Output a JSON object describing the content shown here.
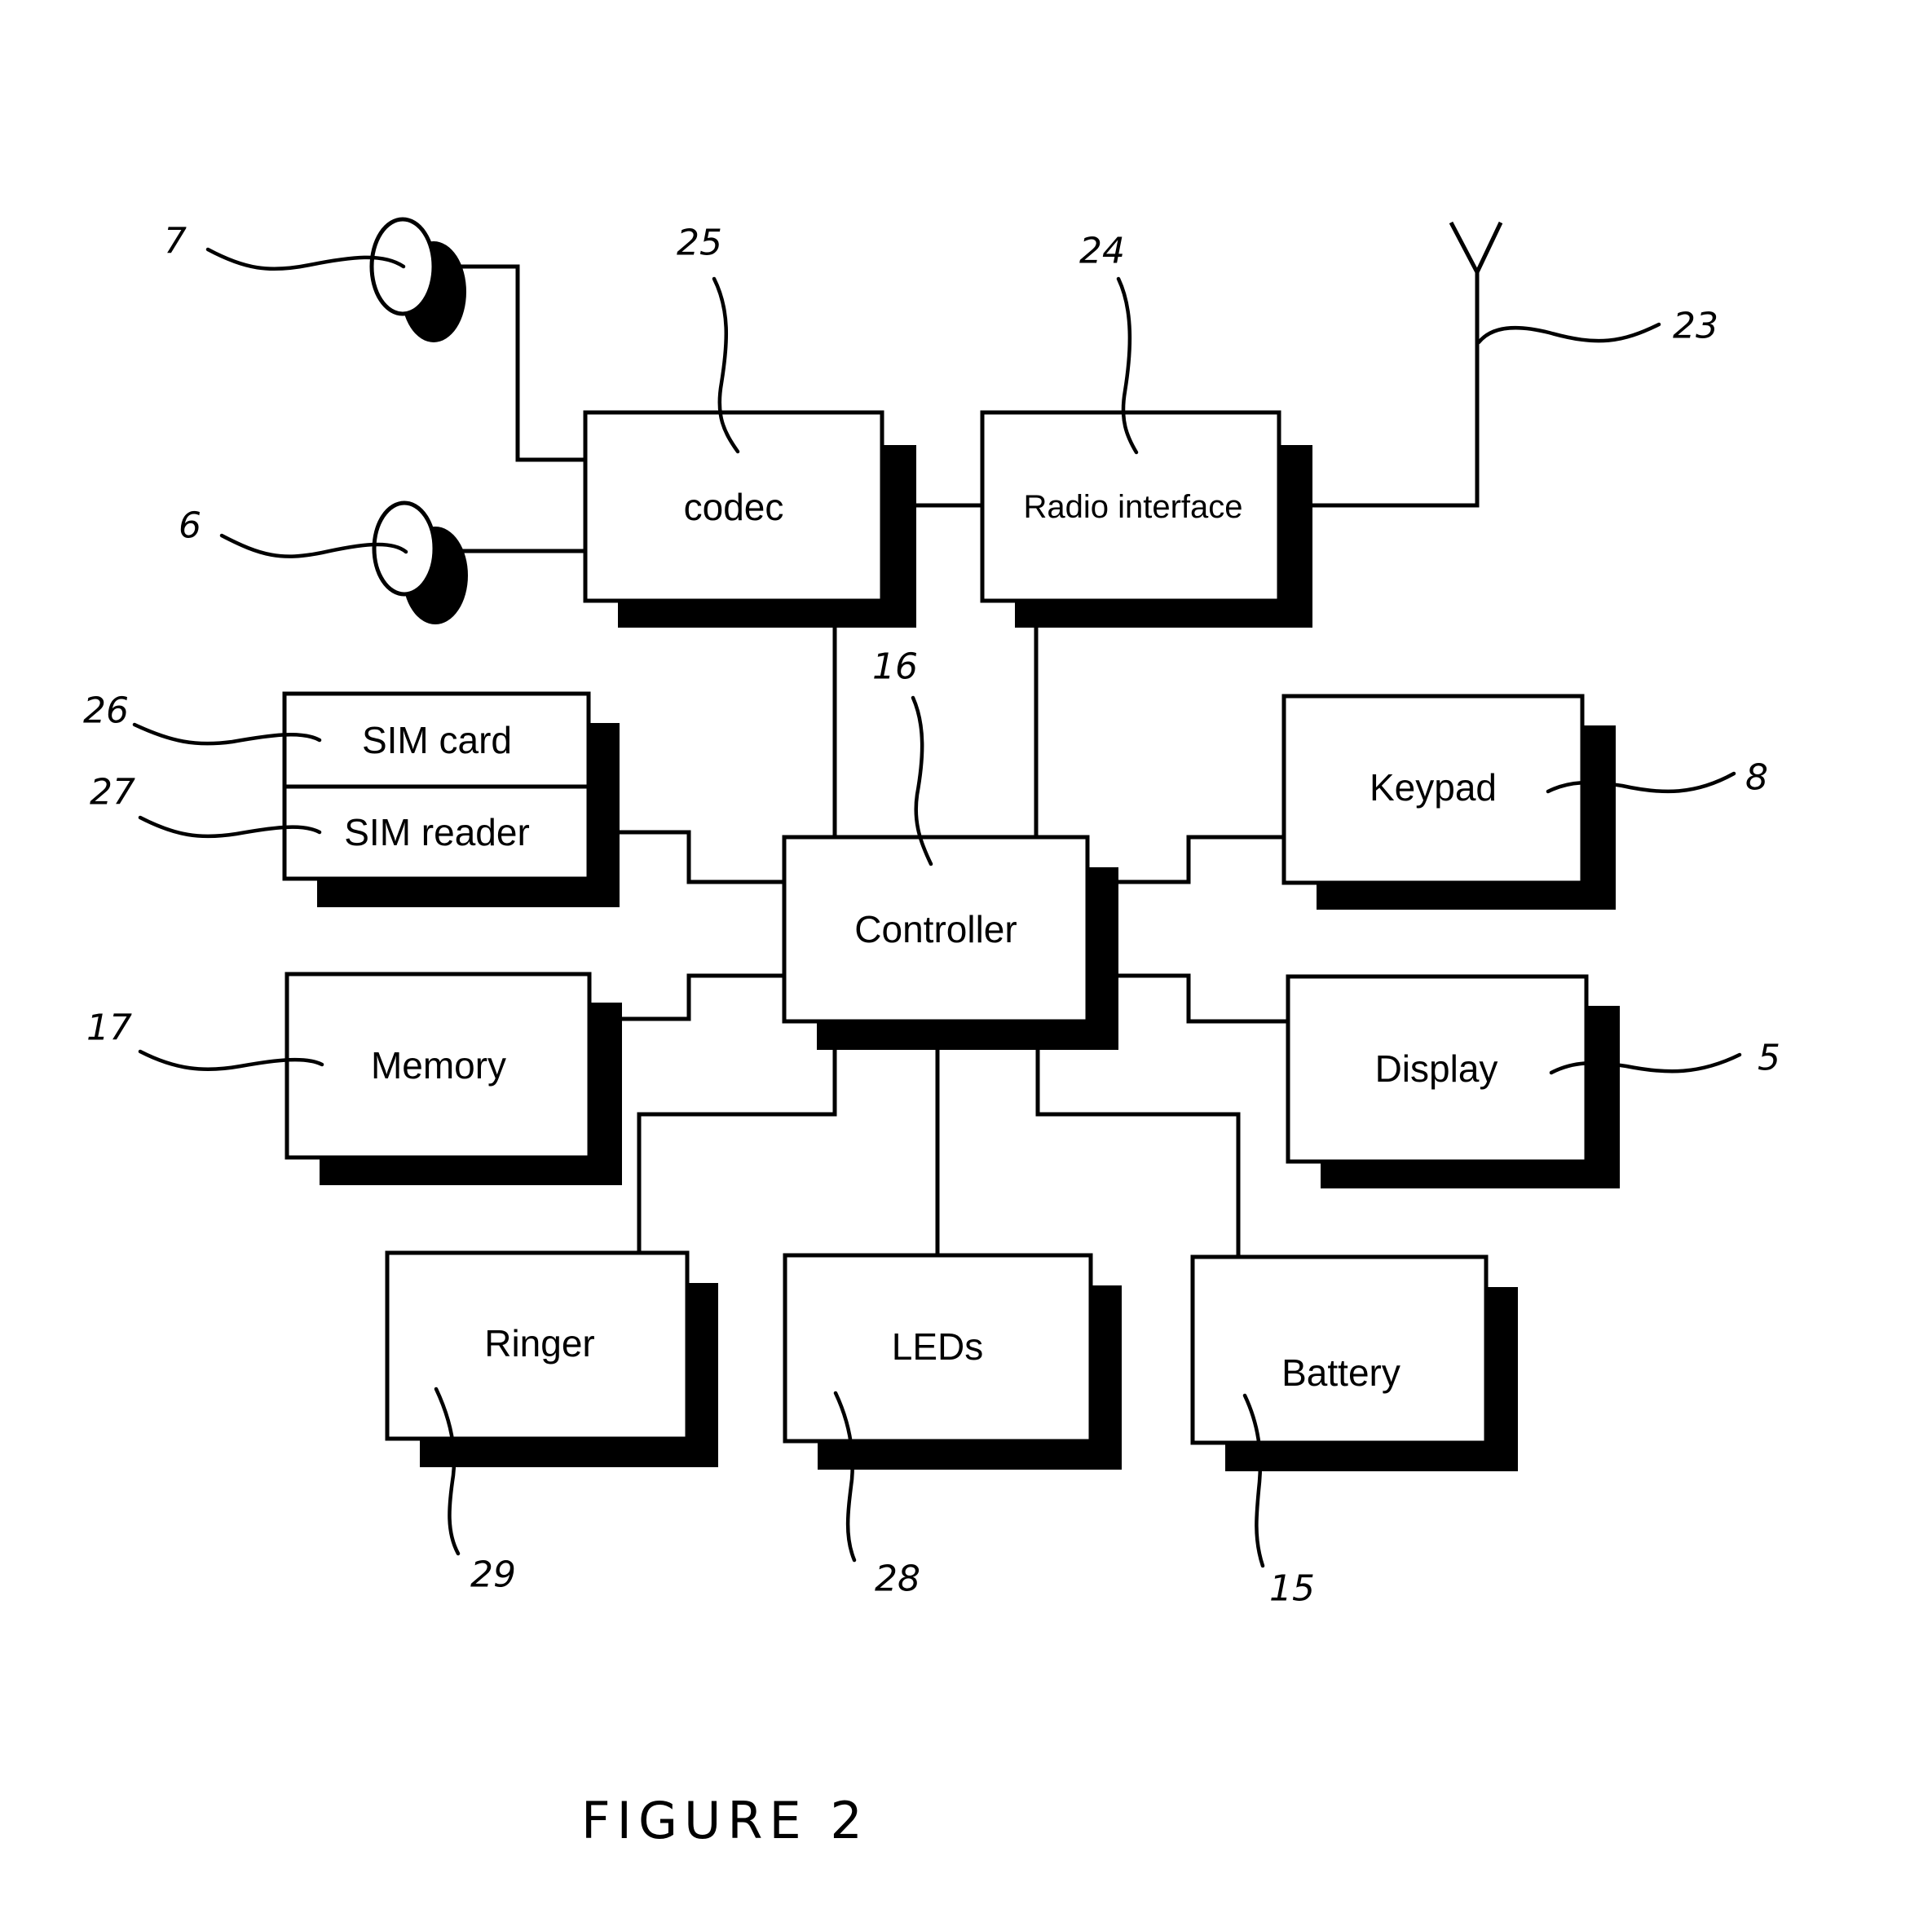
{
  "figure": {
    "caption": "Figure 2",
    "caption_display": "FIGURE 2",
    "type": "block diagram"
  },
  "blocks": {
    "codec": {
      "label": "codec",
      "ref": "25"
    },
    "radio": {
      "label": "Radio interface",
      "ref": "24"
    },
    "sim_card": {
      "label": "SIM card",
      "ref": "26"
    },
    "sim_reader": {
      "label": "SIM reader",
      "ref": "27"
    },
    "memory": {
      "label": "Memory",
      "ref": "17"
    },
    "controller": {
      "label": "Controller",
      "ref": "16"
    },
    "keypad": {
      "label": "Keypad",
      "ref": "8"
    },
    "display": {
      "label": "Display",
      "ref": "5"
    },
    "ringer": {
      "label": "Ringer",
      "ref": "29"
    },
    "leds": {
      "label": "LEDs",
      "ref": "28"
    },
    "battery": {
      "label": "Battery",
      "ref": "15"
    }
  },
  "components": {
    "speaker_top": {
      "ref": "7",
      "kind": "speaker"
    },
    "speaker_bottom": {
      "ref": "6",
      "kind": "microphone"
    },
    "antenna": {
      "ref": "23",
      "kind": "antenna"
    }
  },
  "connections": [
    [
      "speaker_top",
      "codec"
    ],
    [
      "speaker_bottom",
      "codec"
    ],
    [
      "codec",
      "radio"
    ],
    [
      "radio",
      "antenna"
    ],
    [
      "codec",
      "controller"
    ],
    [
      "radio",
      "controller"
    ],
    [
      "sim_reader",
      "controller"
    ],
    [
      "memory",
      "controller"
    ],
    [
      "keypad",
      "controller"
    ],
    [
      "display",
      "controller"
    ],
    [
      "ringer",
      "controller"
    ],
    [
      "leds",
      "controller"
    ],
    [
      "battery",
      "controller"
    ]
  ]
}
